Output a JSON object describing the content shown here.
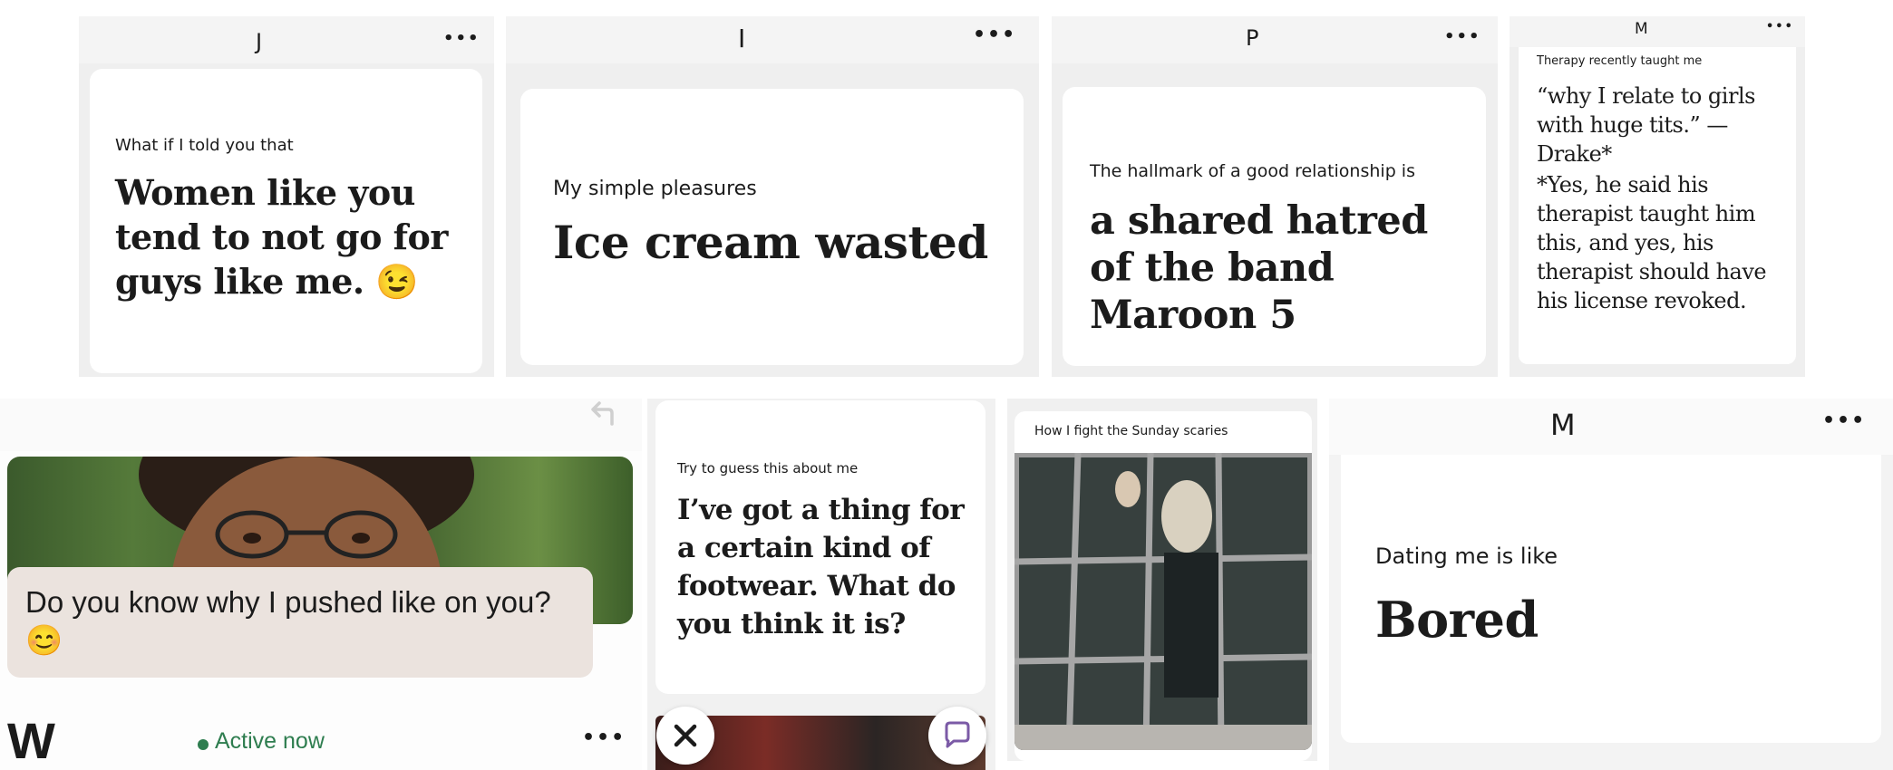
{
  "top_row": [
    {
      "initial": "J",
      "prompt": "What if I told you that",
      "answer": "Women like you tend to not go for guys like me. 😉"
    },
    {
      "initial": "I",
      "prompt": "My simple pleasures",
      "answer": "Ice cream wasted"
    },
    {
      "initial": "P",
      "prompt": "The hallmark of a good relationship is",
      "answer": "a shared hatred of the band Maroon 5"
    },
    {
      "initial": "M",
      "prompt": "Therapy recently taught me",
      "answer": "“why I relate to girls with huge tits.” — Drake*",
      "answer2": "*Yes, he said his therapist taught him this, and yes, his therapist should have his license revoked."
    }
  ],
  "chat_profile": {
    "message": "Do you know why I pushed like on you? 😊",
    "initial": "W",
    "status": "Active now",
    "status_color": "#2e7d4f"
  },
  "guess_card": {
    "prompt": "Try to guess this about me",
    "answer": "I’ve got a thing for a certain kind of footwear. What do you think it is?"
  },
  "scaries_card": {
    "prompt": "How I fight the Sunday scaries"
  },
  "dating_card": {
    "initial": "M",
    "prompt": "Dating me is like",
    "answer": "Bored"
  },
  "more_label": "•••"
}
